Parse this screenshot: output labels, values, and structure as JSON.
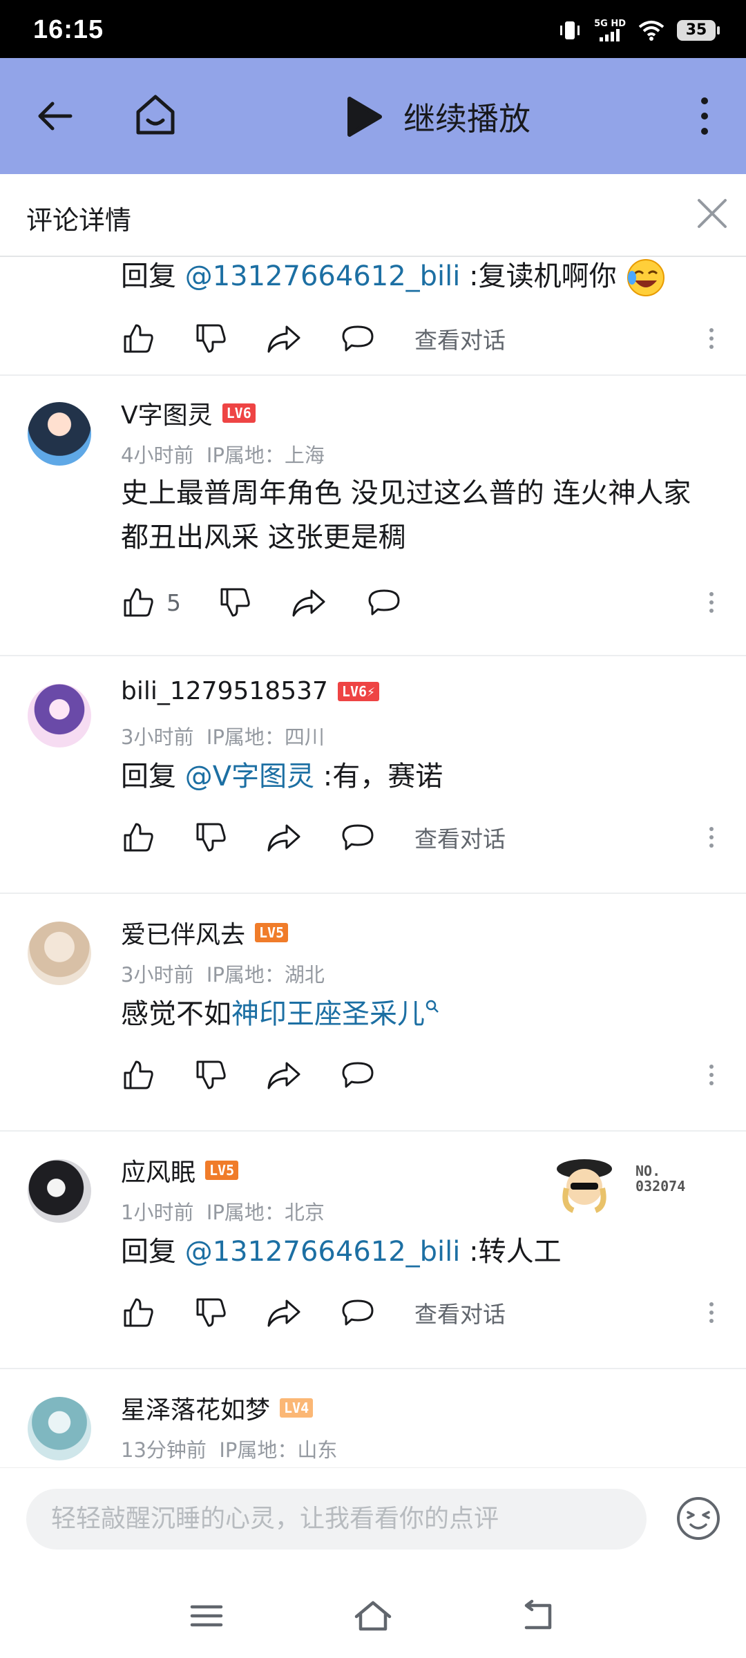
{
  "status_bar": {
    "time": "16:15",
    "network": "5G HD",
    "battery": "35"
  },
  "top_bar": {
    "continue_label": "继续播放"
  },
  "header": {
    "title": "评论详情"
  },
  "partial_comment": {
    "text": {
      "prefix": "回复 ",
      "mention": "@13127664612_bili",
      "body": " :复读机啊你"
    },
    "view_label": "查看对话"
  },
  "comments": [
    {
      "username": "V字图灵",
      "level": "LV6",
      "time": "4小时前",
      "ip": "IP属地：上海",
      "text": "史上最普周年角色 没见过这么普的 连火神人家都丑出风采 这张更是稠",
      "likes": "5"
    },
    {
      "username": "bili_1279518537",
      "level": "LV6⚡",
      "time": "3小时前",
      "ip": "IP属地：四川",
      "text": {
        "prefix": "回复 ",
        "mention": "@V字图灵",
        "body": " :有，赛诺"
      },
      "view_label": "查看对话"
    },
    {
      "username": "爱已伴风去",
      "level": "LV5",
      "time": "3小时前",
      "ip": "IP属地：湖北",
      "text": {
        "prefix": "感觉不如",
        "link": "神印王座圣采儿"
      }
    },
    {
      "username": "应风眠",
      "level": "LV5",
      "time": "1小时前",
      "ip": "IP属地：北京",
      "badge_no": "NO.\n032074",
      "text": {
        "prefix": "回复 ",
        "mention": "@13127664612_bili",
        "body": " :转人工"
      },
      "view_label": "查看对话"
    },
    {
      "username": "星泽落花如梦",
      "level": "LV4",
      "time": "13分钟前",
      "ip": "IP属地：山东"
    }
  ],
  "input": {
    "placeholder": "轻轻敲醒沉睡的心灵，让我看看你的点评"
  },
  "colors": {
    "topbar": "#92a4e8",
    "link": "#1c6fa3",
    "lv6": "#ee4444",
    "lv5": "#f07c2a",
    "lv4": "#fbb775"
  }
}
